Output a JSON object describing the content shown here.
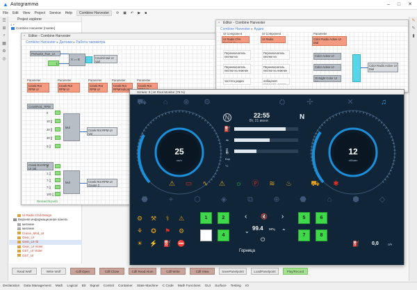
{
  "app": {
    "title": "Autogramma",
    "window_tab": "Combine Harvester",
    "menu": [
      "File",
      "Edit",
      "View",
      "Project",
      "Service",
      "Help"
    ]
  },
  "explorer": {
    "title": "Project explorer",
    "root": "Combine Harvester [master]",
    "items_bottom": [
      "UI Radio Chd Design",
      "Верхняя информационная панель",
      "мигание",
      "мигание",
      "Cruise_Mod_UI",
      "Gear_UI",
      "Gear_UI rib",
      "Gear_UI Violet",
      "GST_UI Violet",
      "GST_UI"
    ]
  },
  "editor_main": {
    "title": "Editor - Combine Harvester",
    "breadcrumb": [
      "Combine Harvester",
      "Датчики",
      "Работа тахометра"
    ],
    "blocks": {
      "prehodor": "Prehodor_Run_UI",
      "one": "1",
      "zero": "0",
      "xmb": "X == B",
      "cmdvalue": "CmdAll.Vail UI Vail",
      "param1": "Crank Rot RPM UI Gauge",
      "param2": "Crank Rot RPM UI Gauge 2",
      "param3": "Crank Rot RPM UI Gauge",
      "param4": "Crank Rot RPM/Indicator UI Gauge",
      "param5": "Crank Rot RPM UI Gauge",
      "param_label": "Parameter",
      "crankrot": "CrankRot1_RPM",
      "mul1": "Mul",
      "out1": "Crank Rot RPM UI Val",
      "crank2": "Crank Rot RPM UI Val",
      "mul2": "Mul",
      "out2": "Crank Rot RPM UI Gauge 2",
      "inputs1": [
        "0",
        "10 []",
        "20 []",
        "30 []",
        "0 []"
      ],
      "inputs2": [
        "0",
        "1 []",
        "7 []",
        "7 []",
        "100 []"
      ],
      "green_label": "ResearchLevel1"
    }
  },
  "editor_right": {
    "title": "Editor - Combine Harvester",
    "breadcrumb": [
      "Combine Harvester",
      "Аудио"
    ],
    "col1": [
      "UI Component",
      "UI Radio ChA Design UI",
      "Переключатель кнопки на верхнюю панель",
      "Переключатель кнопки на нижние панели",
      "частота радио"
    ],
    "col2": [
      "UI Component",
      "UI Radio",
      "Переключатель кнопки на верхнюю панель",
      "Переключатель кнопки на нижние",
      "ообщения громкость радио"
    ],
    "col3": [
      "Parameter",
      "Color Radio Active UI Dial",
      "Color Active UI",
      "Color Active UI",
      "OnNight Color UI Int"
    ],
    "out": "Color Radio Active UI Dial"
  },
  "dashboard": {
    "title": "Screen: 0 | UI Root Monitor (76 %)",
    "time": "22:55",
    "date": "Вт, 21 июня",
    "speed": "25",
    "speed_unit": "км/ч",
    "rpm": "12",
    "rpm_unit": "об/мин",
    "gear_letter": "N",
    "radio_freq": "99.4",
    "radio_unit": "МГц",
    "radio_name": "Горница",
    "left_pads": [
      "1",
      "2",
      "",
      "4"
    ],
    "right_pads": [
      "5",
      "6",
      "7",
      "8"
    ],
    "right_value": "0,0",
    "right_value_unit": "л/ч",
    "small_label_1": "Бар",
    "small_label_2": "°C",
    "colors": {
      "background": "#112538",
      "gauge_ring": "#1d8fd8",
      "warn_red": "#e03028",
      "warn_amber": "#e0a020",
      "warn_green": "#3ec43a",
      "pad_green": "#3fd84a",
      "icon": "#41587a"
    }
  },
  "buttons": [
    "Read Wolf",
    "Write Wolf",
    "Cdll Open",
    "Cdll Close",
    "Cdll Read Alum",
    "Cdll Write",
    "Cdll View",
    "SavePanelpoint",
    "LoadPanelpoint",
    "Play/Record"
  ],
  "tabs": [
    "Declaration",
    "Data Management",
    "Math",
    "Logical",
    "Bit",
    "Signal",
    "Control",
    "Container",
    "State Machine",
    "C Code",
    "Math Functions",
    "GUI",
    "Surface",
    "Testing",
    "IO"
  ]
}
